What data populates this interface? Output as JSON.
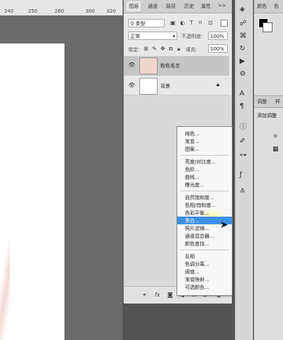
{
  "ruler": {
    "ticks": [
      "240",
      "250",
      "260",
      "300",
      "320"
    ]
  },
  "layers_panel": {
    "tabs": [
      "图层",
      "通道",
      "路径",
      "历史",
      "属性"
    ],
    "more": ">>",
    "kind_filter": "类型",
    "blend_mode": "正常",
    "opacity_label": "不透明度:",
    "opacity_value": "100%",
    "lock_label": "锁定:",
    "fill_label": "填充:",
    "fill_value": "100%",
    "layers": [
      {
        "name": "粉色毛衣",
        "selected": true
      },
      {
        "name": "背景",
        "selected": false,
        "locked": true
      }
    ]
  },
  "adjustment_menu": {
    "groups": [
      [
        "纯色...",
        "渐变...",
        "图案..."
      ],
      [
        "亮度/对比度...",
        "色阶...",
        "曲线...",
        "曝光度..."
      ],
      [
        "自然饱和度...",
        "色相/饱和度...",
        "色彩平衡...",
        "黑白...",
        "照片滤镜...",
        "通道混合器...",
        "颜色查找..."
      ],
      [
        "反相",
        "色调分离...",
        "阈值...",
        "渐变映射...",
        "可选颜色..."
      ]
    ],
    "highlighted": "黑白..."
  },
  "right_panel": {
    "color_tab": "颜色",
    "color_tab2": "色",
    "adjust_tab": "调整",
    "adjust_tab2": "样",
    "add_adjust": "添加调整"
  },
  "colors": {
    "highlight": "#3d8fe5",
    "panel": "#e8e8e8",
    "canvas": "#6b6b6b"
  }
}
